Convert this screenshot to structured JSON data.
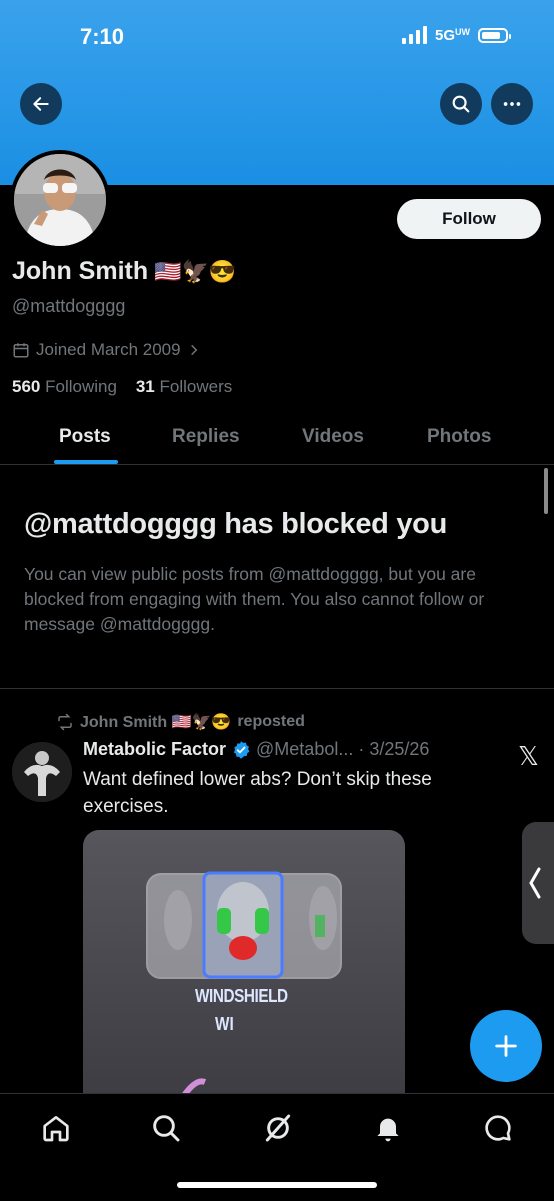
{
  "status_bar": {
    "time": "7:10",
    "network": "5G",
    "network_sup": "UW"
  },
  "header": {
    "back_icon": "arrow-left-icon",
    "search_icon": "search-icon",
    "more_icon": "more-icon",
    "banner_color": "#1d9bf0"
  },
  "profile": {
    "name": "John Smith",
    "name_emoji": "🇺🇸🦅😎",
    "handle": "@mattdogggg",
    "joined": "Joined March 2009",
    "following_count": "560",
    "following_label": "Following",
    "followers_count": "31",
    "followers_label": "Followers",
    "follow_button": "Follow"
  },
  "tabs": [
    {
      "label": "Posts",
      "active": true
    },
    {
      "label": "Replies",
      "active": false
    },
    {
      "label": "Videos",
      "active": false
    },
    {
      "label": "Photos",
      "active": false
    }
  ],
  "blocked": {
    "title": "@mattdogggg has blocked you",
    "body": "You can view public posts from @mattdogggg, but you are blocked from engaging with them. You also cannot follow or message @mattdogggg."
  },
  "post": {
    "repost_user": "John Smith 🇺🇸🦅😎",
    "repost_label": "reposted",
    "author_name": "Metabolic Factor",
    "author_handle": "@Metabol...",
    "date": "· 3/25/26",
    "text": "Want defined lower abs? Don’t skip these exercises.",
    "media_caption_1": "WINDSHIELD",
    "media_caption_2": "WI",
    "x_logo": "𝕏"
  },
  "fab": {
    "icon": "plus-icon"
  },
  "bottom_nav": [
    "home-icon",
    "search-icon",
    "grok-icon",
    "notifications-icon",
    "messages-icon"
  ],
  "colors": {
    "accent": "#1d9bf0",
    "text": "#e7e9ea",
    "muted": "#71767b",
    "border": "#2f3336"
  }
}
